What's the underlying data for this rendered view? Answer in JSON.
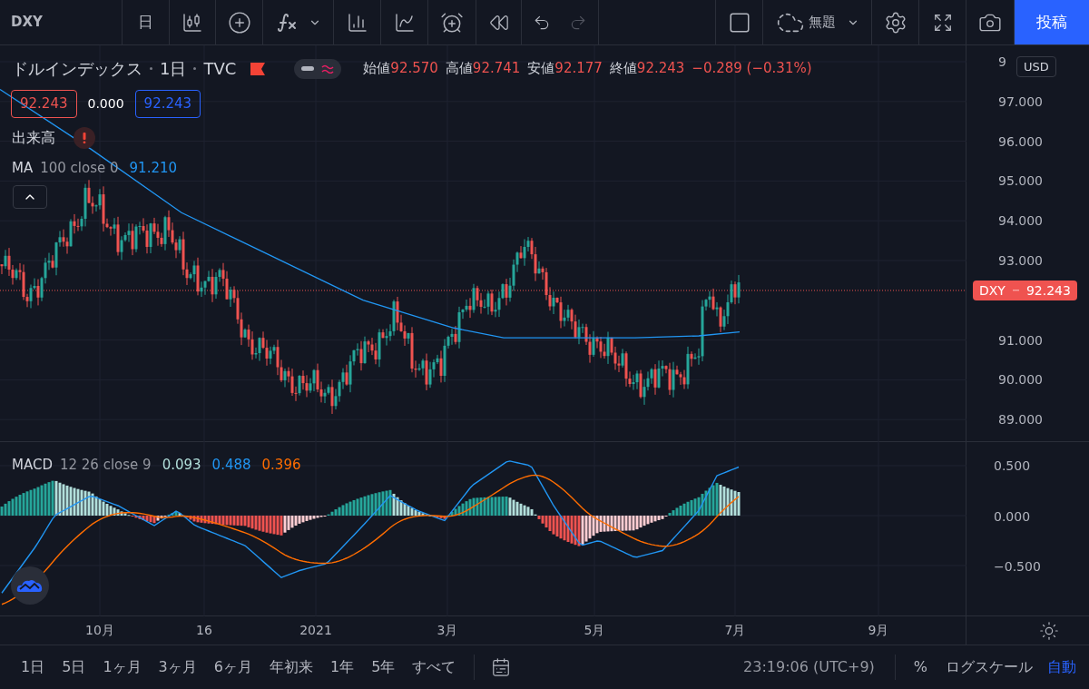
{
  "toolbar": {
    "symbol": "DXY",
    "interval": "日",
    "layout_title": "無題",
    "publish": "投稿"
  },
  "legend": {
    "name": "ドルインデックス",
    "interval": "1日",
    "exchange": "TVC",
    "ohlc": [
      {
        "label": "始値",
        "value": "92.570"
      },
      {
        "label": "高値",
        "value": "92.741"
      },
      {
        "label": "安値",
        "value": "92.177"
      },
      {
        "label": "終値",
        "value": "92.243"
      }
    ],
    "change": "−0.289 (−0.31%)"
  },
  "price_boxes": {
    "sell": "92.243",
    "spread": "0.000",
    "buy": "92.243"
  },
  "volume": {
    "label": "出来高"
  },
  "ma": {
    "name": "MA",
    "params": "100 close 0",
    "value": "91.210"
  },
  "macd": {
    "name": "MACD",
    "params": "12 26 close 9",
    "values": [
      {
        "text": "0.093",
        "color": "#b2dfdb"
      },
      {
        "text": "0.488",
        "color": "#2196f3"
      },
      {
        "text": "0.396",
        "color": "#ff6d00"
      }
    ]
  },
  "price_axis": {
    "currency": "USD",
    "ticks": [
      "9",
      "97.000",
      "96.000",
      "95.000",
      "94.000",
      "93.000",
      "91.000",
      "90.000",
      "89.000"
    ]
  },
  "last_price": {
    "symbol": "DXY",
    "value": "92.243"
  },
  "macd_axis": {
    "ticks": [
      "0.500",
      "0.000",
      "−0.500"
    ]
  },
  "time_axis": {
    "labels": [
      "10月",
      "16",
      "2021",
      "3月",
      "5月",
      "7月",
      "9月"
    ]
  },
  "ranges": [
    {
      "label": "1日"
    },
    {
      "label": "5日"
    },
    {
      "label": "1ヶ月"
    },
    {
      "label": "3ヶ月"
    },
    {
      "label": "6ヶ月"
    },
    {
      "label": "年初来"
    },
    {
      "label": "1年"
    },
    {
      "label": "5年"
    },
    {
      "label": "すべて"
    }
  ],
  "status": {
    "time": "23:19:06 (UTC+9)",
    "percent": "%",
    "log": "ログスケール",
    "auto": {
      "label": "自動",
      "on": true
    }
  }
}
